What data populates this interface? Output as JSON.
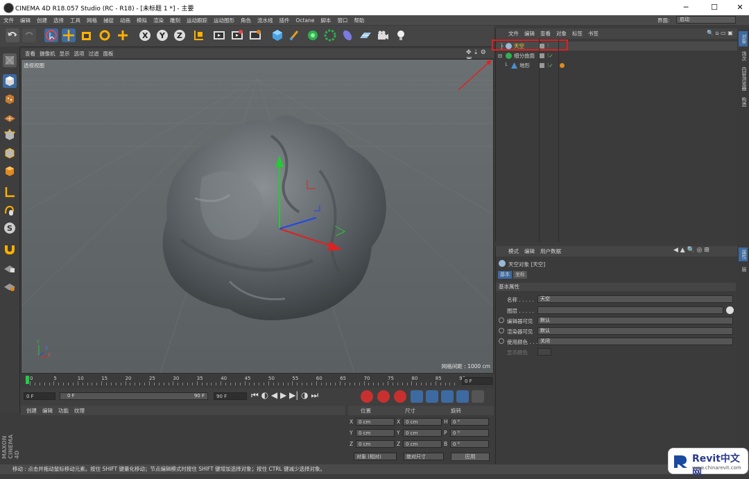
{
  "window": {
    "title": "CINEMA 4D R18.057 Studio (RC - R18) - [未标题 1 *] - 主要",
    "controls": {
      "minimize": "─",
      "maximize": "☐",
      "close": "✕"
    }
  },
  "menubar": {
    "items": [
      "文件",
      "编辑",
      "创建",
      "选择",
      "工具",
      "网格",
      "捕捉",
      "动画",
      "模拟",
      "渲染",
      "雕刻",
      "运动跟踪",
      "运动图形",
      "角色",
      "流水线",
      "插件",
      "Octane",
      "脚本",
      "窗口",
      "帮助"
    ],
    "layout_label": "界面:",
    "layout_value": "启动"
  },
  "viewport": {
    "menu": [
      "查看",
      "摄像机",
      "显示",
      "选项",
      "过滤",
      "面板"
    ],
    "label": "透视视图",
    "grid_spacing": "网格间距 : 1000 cm",
    "axis_x": "X",
    "axis_y": "Y",
    "axis_z": "Z"
  },
  "timeline": {
    "ticks": [
      "0",
      "5",
      "10",
      "15",
      "20",
      "25",
      "30",
      "35",
      "40",
      "45",
      "50",
      "55",
      "60",
      "65",
      "70",
      "75",
      "80",
      "85",
      "90"
    ],
    "end_frame": "0 F",
    "current": "0 F",
    "range_start": "0 F",
    "range_end": "90 F",
    "max": "90 F"
  },
  "material": {
    "menu": [
      "创建",
      "编辑",
      "功能",
      "纹理"
    ]
  },
  "coordinates": {
    "headers": [
      "位置",
      "尺寸",
      "旋转"
    ],
    "rows": [
      {
        "a": "X",
        "av": "0 cm",
        "b": "X",
        "bv": "0 cm",
        "c": "H",
        "cv": "0 °"
      },
      {
        "a": "Y",
        "av": "0 cm",
        "b": "Y",
        "bv": "0 cm",
        "c": "P",
        "cv": "0 °"
      },
      {
        "a": "Z",
        "av": "0 cm",
        "b": "Z",
        "bv": "0 cm",
        "c": "B",
        "cv": "0 °"
      }
    ],
    "mode": "对象 (相对)",
    "size_mode": "绝对尺寸",
    "apply": "应用"
  },
  "object_manager": {
    "menu": [
      "文件",
      "编辑",
      "查看",
      "对象",
      "标签",
      "书签"
    ],
    "objects": [
      {
        "name": "天空"
      },
      {
        "name": "细分曲面"
      },
      {
        "name": "地形"
      }
    ]
  },
  "attribute_manager": {
    "menu": [
      "模式",
      "编辑",
      "用户数据"
    ],
    "title": "天空对象 [天空]",
    "tabs": [
      "基本",
      "坐标"
    ],
    "section": "基本属性",
    "props": [
      {
        "label": "名称 . . . . .",
        "value": "天空"
      },
      {
        "label": "图层 . . . . .",
        "value": ""
      },
      {
        "label": "编辑器可见",
        "value": "默认"
      },
      {
        "label": "渲染器可见",
        "value": "默认"
      },
      {
        "label": "使用颜色 . . .",
        "value": "关闭"
      },
      {
        "label": "显示颜色",
        "value": ""
      }
    ]
  },
  "right_tabs": [
    "对象",
    "场次",
    "内容浏览器",
    "构造",
    "属性",
    "层"
  ],
  "status": "移动 : 点击并拖动鼠标移动元素。按住 SHIFT 键量化移动；节点编辑模式时按住 SHIFT 键增加选择对象；按住 CTRL 键减少选择对象。",
  "brand": {
    "vertical": "MAXON CINEMA 4D"
  },
  "watermark": {
    "name": "Revit中文网",
    "url": "www.chinarevit.com"
  },
  "colors": {
    "accent": "#3d6aa0",
    "highlight_box": "#e02020",
    "sky_label": "#ffcc33",
    "arrow": "#e02020"
  }
}
